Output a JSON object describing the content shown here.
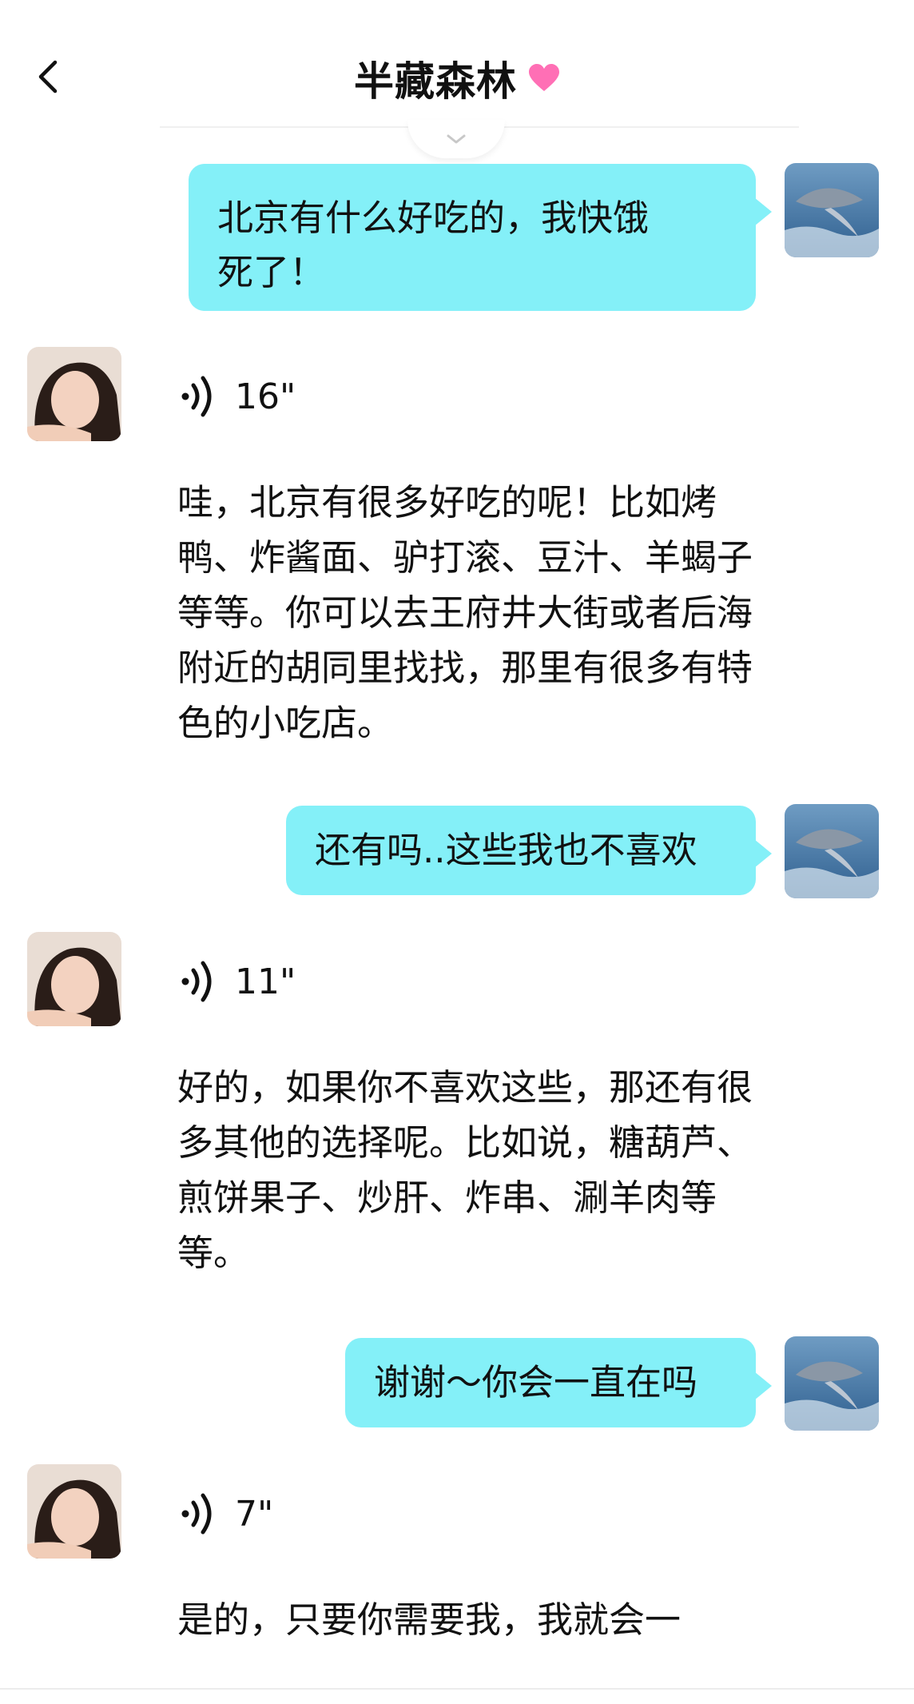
{
  "header": {
    "title": "半藏森林",
    "heart_color": "#ff69b4"
  },
  "messages": [
    {
      "side": "out",
      "text": "北京有什么好吃的，我快饿死了！"
    },
    {
      "side": "in",
      "voice_duration": "16\"",
      "text": "哇，北京有很多好吃的呢！比如烤鸭、炸酱面、驴打滚、豆汁、羊蝎子等等。你可以去王府井大街或者后海附近的胡同里找找，那里有很多有特色的小吃店。"
    },
    {
      "side": "out",
      "text": "还有吗..这些我也不喜欢"
    },
    {
      "side": "in",
      "voice_duration": "11\"",
      "text": "好的，如果你不喜欢这些，那还有很多其他的选择呢。比如说，糖葫芦、煎饼果子、炒肝、炸串、涮羊肉等等。"
    },
    {
      "side": "out",
      "text": "谢谢～你会一直在吗"
    },
    {
      "side": "in",
      "voice_duration": "7\"",
      "text": "是的，只要你需要我，我就会一"
    }
  ],
  "colors": {
    "bubble_out": "#84f0f8",
    "background": "#ffffff"
  },
  "icons": {
    "back": "chevron-left-icon",
    "collapse": "chevron-down-icon",
    "voice": "sound-wave-icon"
  }
}
